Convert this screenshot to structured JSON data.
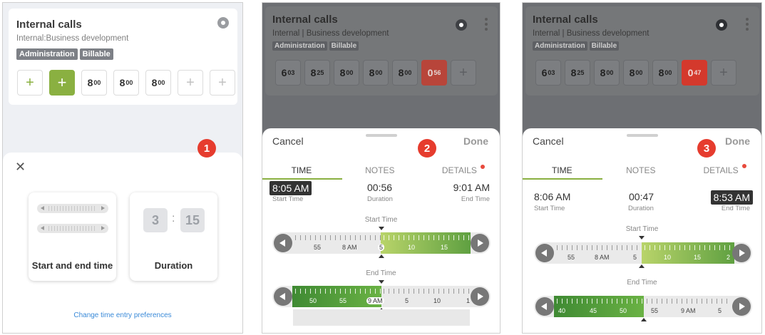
{
  "colors": {
    "green": "#8ab041",
    "red": "#e84a3c",
    "tag_grey": "#7d8086",
    "link_blue": "#3a8ad8"
  },
  "panel1": {
    "card": {
      "title": "Internal calls",
      "subtitle": "Internal:Business development",
      "tags": [
        "Administration",
        "Billable"
      ],
      "days": [
        {
          "kind": "plus-green",
          "text": "+"
        },
        {
          "kind": "plus-solid",
          "text": "+"
        },
        {
          "kind": "time",
          "h": "8",
          "m": "00"
        },
        {
          "kind": "time",
          "h": "8",
          "m": "00"
        },
        {
          "kind": "time",
          "h": "8",
          "m": "00"
        },
        {
          "kind": "plus-light",
          "text": "+"
        },
        {
          "kind": "plus-light",
          "text": "+"
        }
      ]
    },
    "close_icon": "✕",
    "option_start_end": "Start and end time",
    "option_duration": "Duration",
    "duration_hours": "3",
    "duration_minutes": "15",
    "duration_colon": ":",
    "pref_link": "Change time entry preferences",
    "badge": "1"
  },
  "panel2": {
    "card": {
      "title": "Internal calls",
      "subtitle": "Internal | Business development",
      "tags": [
        "Administration",
        "Billable"
      ],
      "days": [
        {
          "kind": "time",
          "h": "6",
          "m": "03"
        },
        {
          "kind": "time",
          "h": "8",
          "m": "25"
        },
        {
          "kind": "time",
          "h": "8",
          "m": "00"
        },
        {
          "kind": "time",
          "h": "8",
          "m": "00"
        },
        {
          "kind": "time",
          "h": "8",
          "m": "00"
        },
        {
          "kind": "red",
          "h": "0",
          "m": "56"
        },
        {
          "kind": "plus-light",
          "text": "+"
        }
      ]
    },
    "cancel": "Cancel",
    "done": "Done",
    "tabs": [
      "TIME",
      "NOTES",
      "DETAILS"
    ],
    "start_time": "8:05 AM",
    "start_caption": "Start Time",
    "duration": "00:56",
    "duration_caption": "Duration",
    "end_time": "9:01 AM",
    "end_caption": "End Time",
    "start_ruler_label": "Start Time",
    "end_ruler_label": "End Time",
    "start_ruler_ticks": [
      "55",
      "8 AM",
      "5",
      "10",
      "15"
    ],
    "end_ruler_ticks": [
      "50",
      "55",
      "9 AM",
      "5",
      "10",
      "1"
    ],
    "badge": "2"
  },
  "panel3": {
    "card": {
      "title": "Internal calls",
      "subtitle": "Internal | Business development",
      "tags": [
        "Administration",
        "Billable"
      ],
      "days": [
        {
          "kind": "time",
          "h": "6",
          "m": "03"
        },
        {
          "kind": "time",
          "h": "8",
          "m": "25"
        },
        {
          "kind": "time",
          "h": "8",
          "m": "00"
        },
        {
          "kind": "time",
          "h": "8",
          "m": "00"
        },
        {
          "kind": "time",
          "h": "8",
          "m": "00"
        },
        {
          "kind": "red",
          "h": "0",
          "m": "47"
        },
        {
          "kind": "plus-light",
          "text": "+"
        }
      ]
    },
    "cancel": "Cancel",
    "done": "Done",
    "tabs": [
      "TIME",
      "NOTES",
      "DETAILS"
    ],
    "start_time": "8:06 AM",
    "start_caption": "Start Time",
    "duration": "00:47",
    "duration_caption": "Duration",
    "end_time": "8:53 AM",
    "end_caption": "End Time",
    "start_ruler_label": "Start Time",
    "end_ruler_label": "End Time",
    "start_ruler_ticks": [
      "55",
      "8 AM",
      "5",
      "10",
      "15",
      "2"
    ],
    "end_ruler_ticks": [
      "40",
      "45",
      "50",
      "55",
      "9 AM",
      "5"
    ],
    "badge": "3"
  }
}
